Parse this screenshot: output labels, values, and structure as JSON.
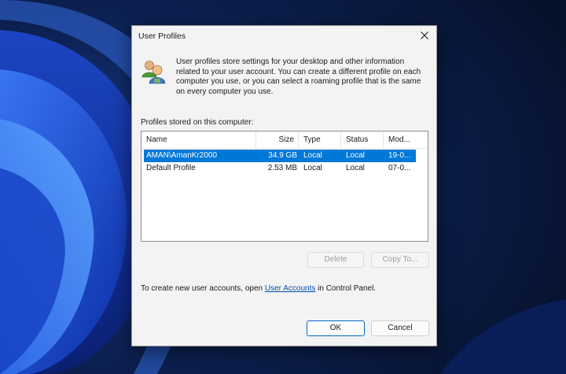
{
  "dialog": {
    "title": "User Profiles",
    "description": "User profiles store settings for your desktop and other information related to your user account. You can create a different profile on each computer you use, or you can select a roaming profile that is the same on every computer you use.",
    "list_label": "Profiles stored on this computer:",
    "columns": {
      "name": "Name",
      "size": "Size",
      "type": "Type",
      "status": "Status",
      "modified": "Mod..."
    },
    "rows": [
      {
        "name": "AMAN\\AmanKr2000",
        "size": "34.9 GB",
        "type": "Local",
        "status": "Local",
        "modified": "19-0...",
        "selected": true
      },
      {
        "name": "Default Profile",
        "size": "2.53 MB",
        "type": "Local",
        "status": "Local",
        "modified": "07-0...",
        "selected": false
      }
    ],
    "buttons": {
      "delete": "Delete",
      "copy_to": "Copy To...",
      "ok": "OK",
      "cancel": "Cancel"
    },
    "footer": {
      "prefix": "To create new user accounts, open ",
      "link": "User Accounts",
      "suffix": " in Control Panel."
    }
  },
  "icons": {
    "close": "close-icon",
    "profile": "user-profiles-icon"
  },
  "colors": {
    "selection": "#0078d7",
    "link": "#0050b3",
    "dialog_bg": "#f3f3f3",
    "wallpaper": "#0a1a3a"
  }
}
